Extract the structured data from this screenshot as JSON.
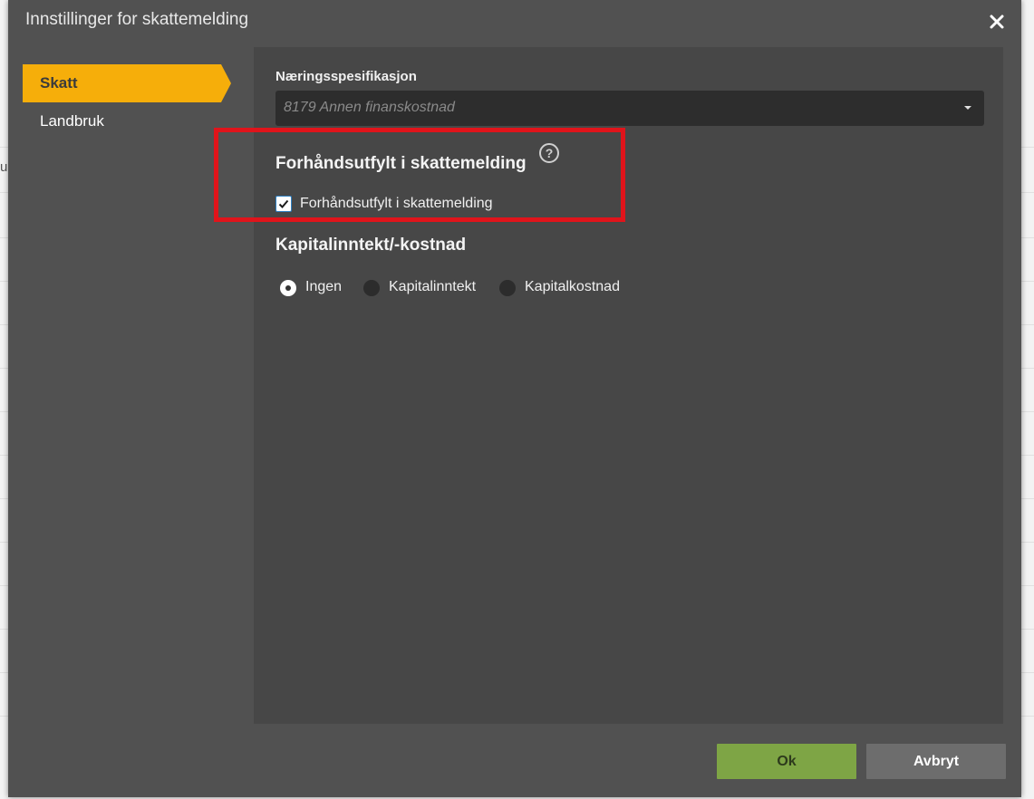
{
  "background": {
    "fragment_text": "u"
  },
  "dialog": {
    "title": "Innstillinger for skattemelding",
    "close_icon": "close-icon"
  },
  "sidebar": {
    "items": [
      {
        "label": "Skatt",
        "active": true
      },
      {
        "label": "Landbruk",
        "active": false
      }
    ]
  },
  "panel": {
    "naering": {
      "label": "Næringsspesifikasjon",
      "selected_value": "8179 Annen finanskostnad"
    },
    "prefilled": {
      "heading": "Forhåndsutfylt i skattemelding",
      "help_icon": "question-circle-icon",
      "checkbox_label": "Forhåndsutfylt i skattemelding",
      "checked": true
    },
    "kapital": {
      "heading": "Kapitalinntekt/-kostnad",
      "options": [
        {
          "label": "Ingen",
          "checked": true
        },
        {
          "label": "Kapitalinntekt",
          "checked": false
        },
        {
          "label": "Kapitalkostnad",
          "checked": false
        }
      ]
    }
  },
  "footer": {
    "ok_label": "Ok",
    "cancel_label": "Avbryt"
  },
  "colors": {
    "accent": "#f6ae0a",
    "ok_button": "#7ea545",
    "highlight": "#e0141b"
  }
}
